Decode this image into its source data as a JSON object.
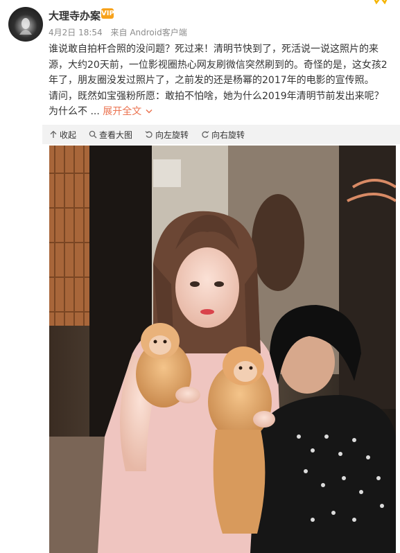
{
  "post": {
    "author": "大理寺办案",
    "badge": "VIP",
    "date": "4月2日 18:54",
    "source": "来自 Android客户端",
    "paragraph1": "谁说敢自拍杆合照的没问题？死过来！清明节快到了，死活说一说这照片的来源，大约20天前，一位影视圈热心网友刷微信突然刷到的。奇怪的是，这女孩2年了，朋友圈没发过照片了，之前发的还是杨幂的2017年的电影的宣传照。",
    "paragraph2_prefix": "请问，既然如宝强粉所愿：敢拍不怕啥，她为什么2019年清明节前发出来呢？为什么不 ... ",
    "expand_label": "展开全文"
  },
  "toolbar": {
    "collapse": "收起",
    "view_large": "查看大图",
    "rotate_left": "向左旋转",
    "rotate_right": "向右旋转"
  },
  "icons": {
    "collapse": "arrow-up-icon",
    "view_large": "magnifier-icon",
    "rotate_left": "rotate-left-icon",
    "rotate_right": "rotate-right-icon",
    "expand": "chevron-down-icon",
    "corner": "corner-star-icon"
  },
  "colors": {
    "link": "#eb7350",
    "toolbar_bg": "#f2f2f2",
    "meta": "#8c8c8c",
    "badge": "#f7a21b"
  }
}
